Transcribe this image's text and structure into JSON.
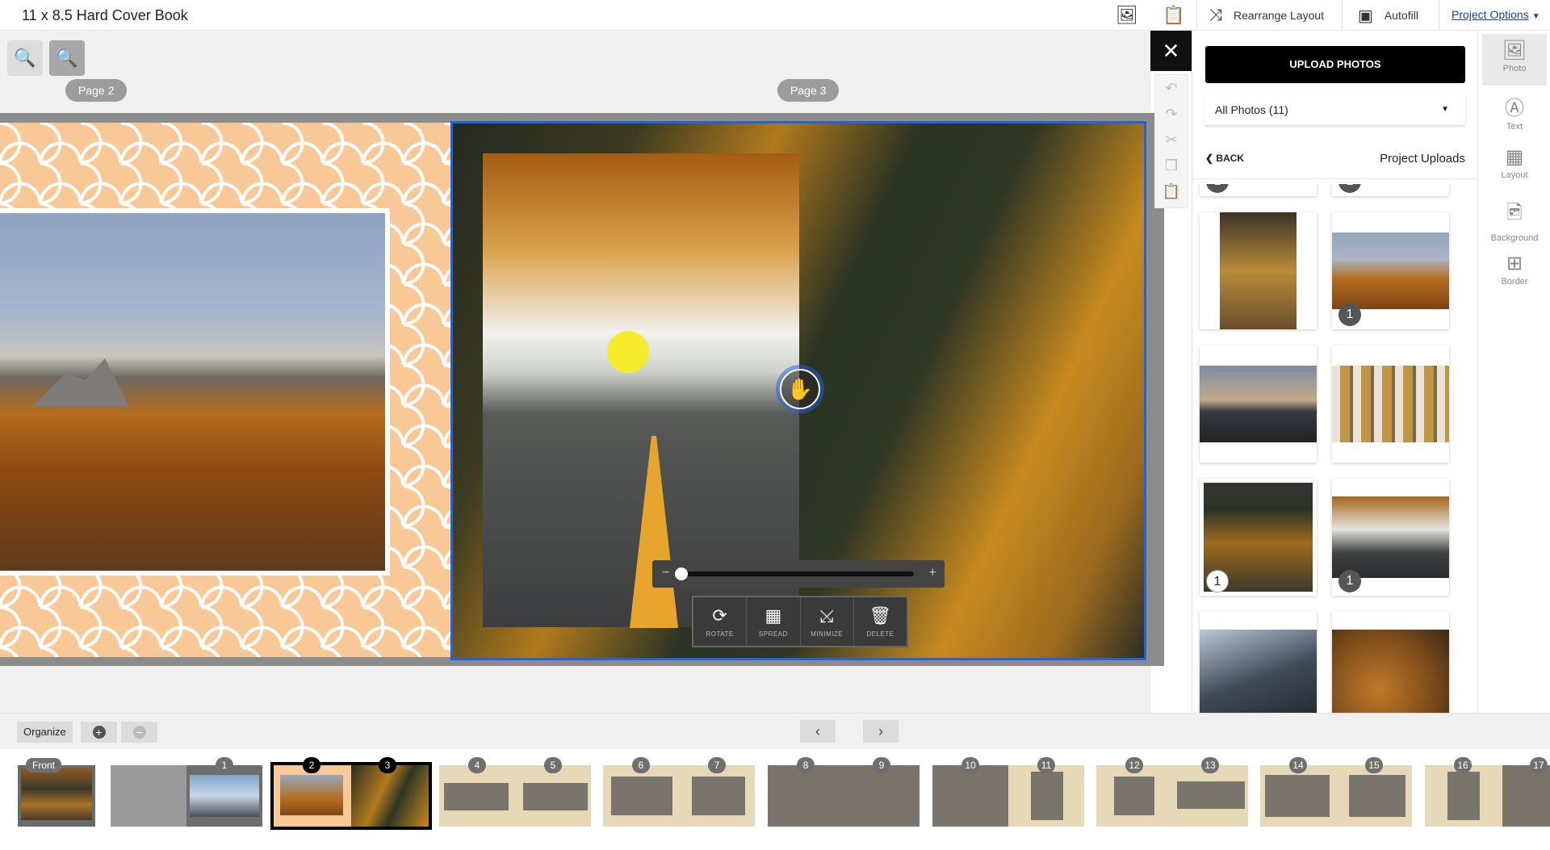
{
  "app": {
    "title": "11 x 8.5 Hard Cover Book"
  },
  "toolbar": {
    "add_photo_icon": "add-photo-icon",
    "add_page_icon": "add-page-icon",
    "rearrange_label": "Rearrange Layout",
    "autofill_label": "Autofill",
    "project_options_label": "Project Options"
  },
  "canvas": {
    "page_left_label": "Page 2",
    "page_right_label": "Page 3",
    "photo_tools": [
      {
        "label": "ROTATE",
        "icon": "rotate-icon"
      },
      {
        "label": "SPREAD",
        "icon": "spread-icon"
      },
      {
        "label": "MINIMIZE",
        "icon": "minimize-icon"
      },
      {
        "label": "DELETE",
        "icon": "trash-icon"
      }
    ]
  },
  "panel": {
    "upload_label": "UPLOAD PHOTOS",
    "filter_value": "All Photos (11)",
    "back_label": "BACK",
    "section_title": "Project Uploads",
    "thumb_badges": [
      "1",
      "1",
      "1",
      "1",
      "1"
    ]
  },
  "rail": [
    {
      "label": "Photo",
      "icon": "photo-icon",
      "active": true
    },
    {
      "label": "Text",
      "icon": "text-icon"
    },
    {
      "label": "Layout",
      "icon": "layout-icon"
    },
    {
      "label": "Background",
      "icon": "background-icon"
    },
    {
      "label": "Border",
      "icon": "border-icon"
    }
  ],
  "bottom": {
    "organize_label": "Organize",
    "add_symbol": "+",
    "remove_symbol": "−",
    "prev_symbol": "‹",
    "next_symbol": "›"
  },
  "filmstrip": {
    "front_label": "Front",
    "page_numbers": [
      "1",
      "2",
      "3",
      "4",
      "5",
      "6",
      "7",
      "8",
      "9",
      "10",
      "11",
      "12",
      "13",
      "14",
      "15",
      "16",
      "17"
    ]
  },
  "colors": {
    "accent_blue": "#1e63e0",
    "pattern_peach": "#f8c896",
    "link_blue": "#1a3ea8"
  }
}
